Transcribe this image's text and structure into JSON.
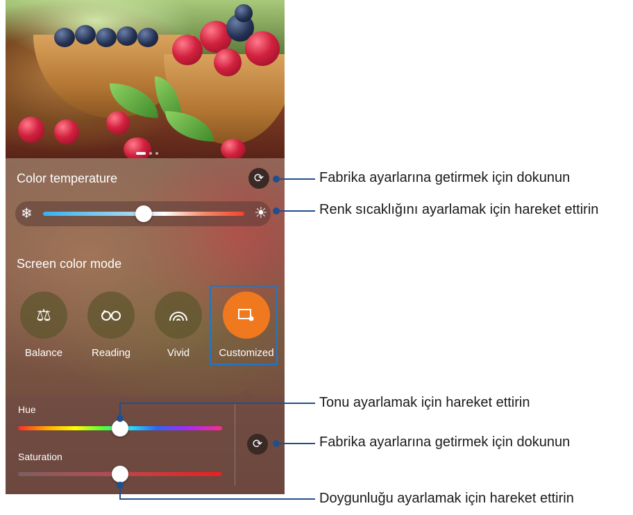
{
  "color_temperature": {
    "title": "Color temperature",
    "cold_icon": "snowflake-icon",
    "warm_icon": "sun-icon",
    "reset_icon": "refresh-icon",
    "level": 0.5
  },
  "screen_color_mode": {
    "title": "Screen color mode",
    "modes": [
      {
        "label": "Balance",
        "icon": "balance-scale-icon",
        "selected": false
      },
      {
        "label": "Reading",
        "icon": "reading-glasses-icon",
        "selected": false
      },
      {
        "label": "Vivid",
        "icon": "vivid-rainbow-icon",
        "selected": false
      },
      {
        "label": "Customized",
        "icon": "customized-screen-icon",
        "selected": true
      }
    ],
    "accent_color": "#f0781e"
  },
  "customized_panel": {
    "hue_label": "Hue",
    "saturation_label": "Saturation",
    "hue_level": 0.5,
    "saturation_level": 0.5,
    "reset_icon": "refresh-icon"
  },
  "callouts": {
    "reset_top": "Fabrika ayarlarına getirmek için dokunun",
    "temperature_slider": "Renk sıcaklığını ayarlamak için hareket ettirin",
    "hue_slider": "Tonu ayarlamak için hareket ettirin",
    "reset_bottom": "Fabrika ayarlarına getirmek için dokunun",
    "saturation_slider": "Doygunluğu ayarlamak için hareket ettirin"
  },
  "annotation_color": "#1f4f8f"
}
